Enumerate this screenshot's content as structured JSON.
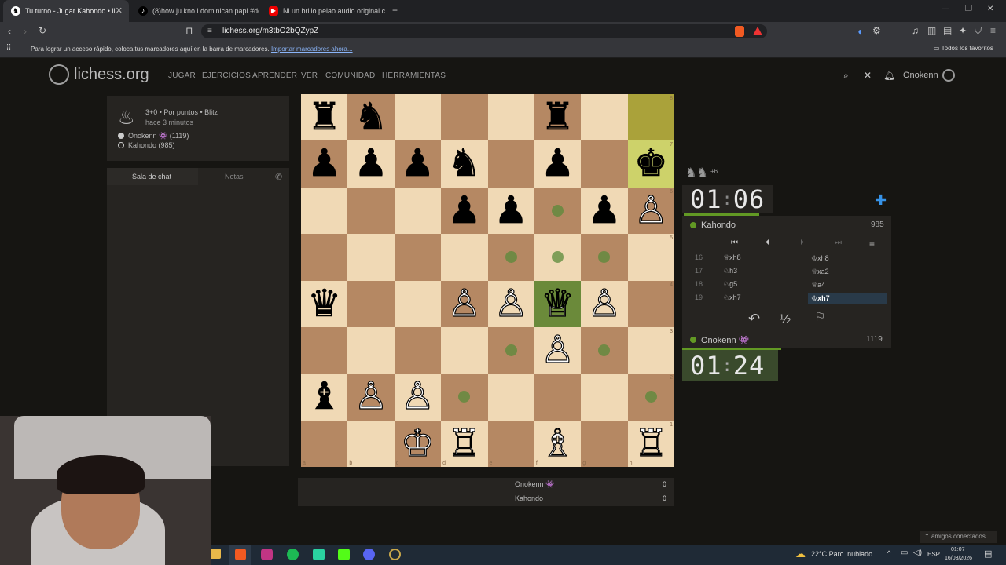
{
  "browser": {
    "tabs": [
      {
        "title": "Tu turno - Jugar Kahondo • li",
        "active": true,
        "icon": "lichess-icon"
      },
      {
        "title": "(8)how ju kno i dominican papi #do",
        "active": false,
        "icon": "tiktok-icon"
      },
      {
        "title": "Ni un brillo pelao audio original con",
        "active": false,
        "icon": "youtube-icon"
      }
    ],
    "url": "lichess.org/m3tbO2bQZypZ",
    "bookmarks_message": "Para lograr un acceso rápido, coloca tus marcadores aquí en la barra de marcadores.",
    "bookmarks_link": "Importar marcadores ahora...",
    "all_favorites": "Todos los favoritos"
  },
  "site": {
    "logo": "lichess.org",
    "nav": [
      "JUGAR",
      "EJERCICIOS",
      "APRENDER",
      "VER",
      "COMUNIDAD",
      "HERRAMIENTAS"
    ],
    "user": "Onokenn"
  },
  "game": {
    "mode": "3+0 • Por puntos • Blitz",
    "time_ago": "hace 3 minutos",
    "player1": "Onokenn 👾 (1119)",
    "player2": "Kahondo (985)"
  },
  "chat": {
    "tab_chat": "Sala de chat",
    "tab_notes": "Notas"
  },
  "board": {
    "ranks": [
      "8",
      "7",
      "6",
      "5",
      "4",
      "3",
      "2",
      "1"
    ],
    "files": [
      "a",
      "b",
      "c",
      "d",
      "e",
      "f",
      "g",
      "h"
    ],
    "pieces": [
      {
        "sq": "a8",
        "p": "♜",
        "c": "b"
      },
      {
        "sq": "b8",
        "p": "♞",
        "c": "b"
      },
      {
        "sq": "f8",
        "p": "♜",
        "c": "b"
      },
      {
        "sq": "a7",
        "p": "♟",
        "c": "b"
      },
      {
        "sq": "b7",
        "p": "♟",
        "c": "b"
      },
      {
        "sq": "c7",
        "p": "♟",
        "c": "b"
      },
      {
        "sq": "d7",
        "p": "♞",
        "c": "b"
      },
      {
        "sq": "f7",
        "p": "♟",
        "c": "b"
      },
      {
        "sq": "h7",
        "p": "♚",
        "c": "b"
      },
      {
        "sq": "d6",
        "p": "♟",
        "c": "b"
      },
      {
        "sq": "e6",
        "p": "♟",
        "c": "b"
      },
      {
        "sq": "g6",
        "p": "♟",
        "c": "b"
      },
      {
        "sq": "h6",
        "p": "♙",
        "c": "w"
      },
      {
        "sq": "a4",
        "p": "♛",
        "c": "b"
      },
      {
        "sq": "d4",
        "p": "♙",
        "c": "w"
      },
      {
        "sq": "e4",
        "p": "♙",
        "c": "w"
      },
      {
        "sq": "f4",
        "p": "♕",
        "c": "w"
      },
      {
        "sq": "g4",
        "p": "♙",
        "c": "w"
      },
      {
        "sq": "f3",
        "p": "♙",
        "c": "w"
      },
      {
        "sq": "a2",
        "p": "♝",
        "c": "b"
      },
      {
        "sq": "b2",
        "p": "♙",
        "c": "w"
      },
      {
        "sq": "c2",
        "p": "♙",
        "c": "w"
      },
      {
        "sq": "c1",
        "p": "♔",
        "c": "w"
      },
      {
        "sq": "d1",
        "p": "♖",
        "c": "w"
      },
      {
        "sq": "f1",
        "p": "♗",
        "c": "w"
      },
      {
        "sq": "h1",
        "p": "♖",
        "c": "w"
      }
    ],
    "dots": [
      "f6",
      "e5",
      "f5",
      "g5",
      "e3",
      "g3",
      "d2",
      "h2"
    ]
  },
  "clocks": {
    "top_min": "01",
    "top_sec": "06",
    "bottom_min": "01",
    "bottom_sec": "24",
    "captured_bonus": "+6"
  },
  "players": {
    "top": {
      "name": "Kahondo",
      "rating": "985"
    },
    "bottom": {
      "name": "Onokenn 👾",
      "rating": "1119"
    }
  },
  "moves": [
    {
      "num": "16",
      "w": "♕xh8",
      "b": "♔xh8"
    },
    {
      "num": "17",
      "w": "♘h3",
      "b": "♕xa2"
    },
    {
      "num": "18",
      "w": "♘g5",
      "b": "♕a4"
    },
    {
      "num": "19",
      "w": "♘xh7",
      "b": "♔xh7"
    }
  ],
  "draw_label": "½",
  "score": {
    "p1": "Onokenn 👾",
    "p1_score": "0",
    "p2": "Kahondo",
    "p2_score": "0"
  },
  "taskbar": {
    "weather": "22°C  Parc. nublado",
    "lang": "ESP",
    "time": "01:07",
    "date": "16/03/2026",
    "friends": "amigos conectados"
  }
}
